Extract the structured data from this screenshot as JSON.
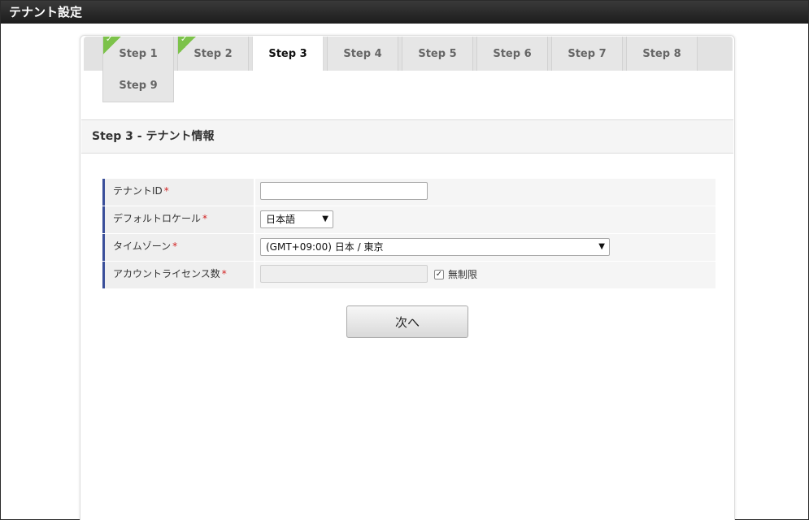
{
  "window": {
    "title": "テナント設定"
  },
  "tabs": [
    {
      "label": "Step 1",
      "completed": true,
      "active": false
    },
    {
      "label": "Step 2",
      "completed": true,
      "active": false
    },
    {
      "label": "Step 3",
      "completed": false,
      "active": true
    },
    {
      "label": "Step 4",
      "completed": false,
      "active": false
    },
    {
      "label": "Step 5",
      "completed": false,
      "active": false
    },
    {
      "label": "Step 6",
      "completed": false,
      "active": false
    },
    {
      "label": "Step 7",
      "completed": false,
      "active": false
    },
    {
      "label": "Step 8",
      "completed": false,
      "active": false
    },
    {
      "label": "Step 9",
      "completed": false,
      "active": false
    }
  ],
  "check_glyph": "✓",
  "step_header": "Step 3 - テナント情報",
  "form": {
    "required_mark": "*",
    "tenant_id": {
      "label": "テナントID",
      "value": ""
    },
    "locale": {
      "label": "デフォルトロケール",
      "value": "日本語"
    },
    "timezone": {
      "label": "タイムゾーン",
      "value": "(GMT+09:00) 日本 / 東京"
    },
    "license": {
      "label": "アカウントライセンス数",
      "value": "",
      "unlimited_label": "無制限",
      "unlimited_checked": true
    }
  },
  "next_button": "次へ",
  "colors": {
    "accent_bar": "#3a4f9a",
    "required": "#d22222",
    "completed_check": "#7cc24a"
  }
}
